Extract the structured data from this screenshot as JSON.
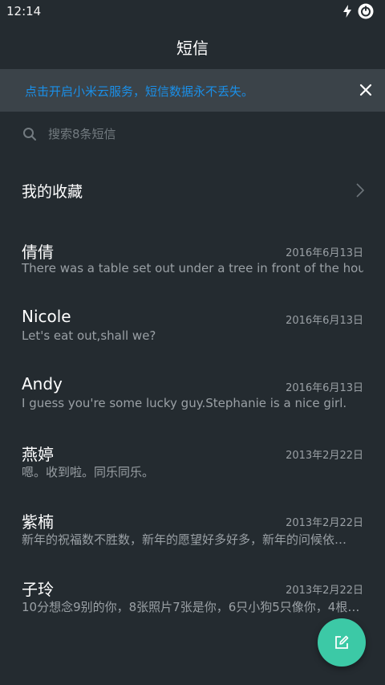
{
  "status_bar": {
    "time": "12:14",
    "icons": [
      "charging-bolt-icon",
      "battery-icon"
    ]
  },
  "header": {
    "title": "短信"
  },
  "banner": {
    "text": "点击开启小米云服务，短信数据永不丢失。",
    "close_icon": "close-icon",
    "text_color": "#1a8fe8"
  },
  "search": {
    "placeholder": "搜索8条短信",
    "icon": "search-icon"
  },
  "favorites": {
    "label": "我的收藏",
    "icon": "chevron-right-icon"
  },
  "conversations": [
    {
      "name": "倩倩",
      "date": "2016年6月13日",
      "preview": "There was a table set out under a tree in front of the hous"
    },
    {
      "name": "Nicole",
      "date": "2016年6月13日",
      "preview": "Let's eat out,shall we?"
    },
    {
      "name": "Andy",
      "date": "2016年6月13日",
      "preview": "I guess you're some lucky guy.Stephanie is a nice girl."
    },
    {
      "name": "燕婷",
      "date": "2013年2月22日",
      "preview": "嗯。收到啦。同乐同乐。"
    },
    {
      "name": "紫楠",
      "date": "2013年2月22日",
      "preview": "新年的祝福数不胜数，新年的愿望好多好多，新年的问候依…"
    },
    {
      "name": "子玲",
      "date": "2013年2月22日",
      "preview": "10分想念9别的你，8张照片7张是你，6只小狗5只像你，4根…"
    }
  ],
  "fab": {
    "icon": "compose-icon",
    "color": "#3cc9a6"
  },
  "colors": {
    "background": "#242b30",
    "banner_background": "#3b4349",
    "secondary_text": "#9aa0a5"
  }
}
